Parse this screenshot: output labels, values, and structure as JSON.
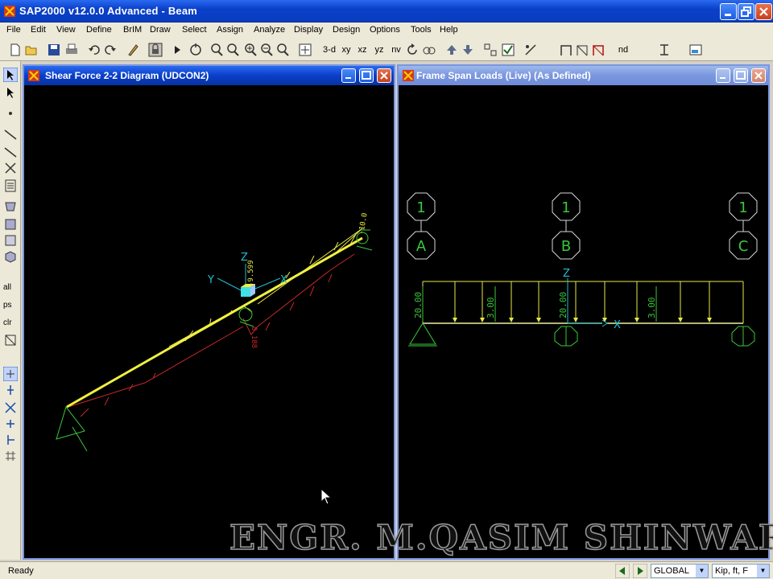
{
  "app": {
    "title": "SAP2000 v12.0.0 Advanced  - Beam"
  },
  "menu": [
    "File",
    "Edit",
    "View",
    "Define",
    "BrIM",
    "Draw",
    "Select",
    "Assign",
    "Analyze",
    "Display",
    "Design",
    "Options",
    "Tools",
    "Help"
  ],
  "toolbar": {
    "view_3d": "3-d",
    "view_xy": "xy",
    "view_xz": "xz",
    "view_yz": "yz",
    "view_nv": "nv",
    "nd": "nd"
  },
  "left_toolbar": {
    "all": "all",
    "ps": "ps",
    "clr": "clr"
  },
  "left_window": {
    "title": "Shear Force 2-2 Diagram   (UDCON2)",
    "labels": {
      "z": "Z",
      "y": "Y",
      "x": "X",
      "val_top": "-10.0",
      "val_mid": "-9.599",
      "val_mid2": "8.188"
    }
  },
  "right_window": {
    "title": "Frame Span Loads (Live) (As Defined)",
    "grid_bubbles_top": [
      "1",
      "1",
      "1"
    ],
    "grid_bubbles_bottom": [
      "A",
      "B",
      "C"
    ],
    "load_labels": [
      "20.00",
      "3.00",
      "20.00",
      "3.00"
    ],
    "axis_z": "Z",
    "axis_x": "X"
  },
  "watermark": "ENGR. M.QASIM SHINWARI",
  "status": {
    "text": "Ready",
    "coord_system": "GLOBAL",
    "units": "Kip, ft, F"
  },
  "colors": {
    "accent": "#0a3fc9",
    "grid_green": "#3ac83a",
    "load_yellow": "#e8e848",
    "shear_red": "#c82828"
  }
}
